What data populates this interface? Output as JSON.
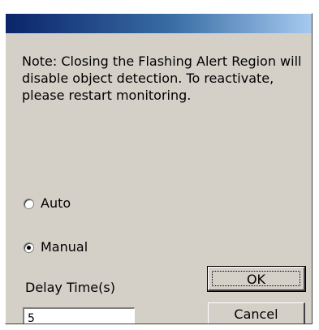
{
  "dialog": {
    "note": "Note: Closing the Flashing Alert Region will disable object detection. To reactivate, please restart monitoring."
  },
  "mode": {
    "options": [
      {
        "label": "Auto",
        "selected": false
      },
      {
        "label": "Manual",
        "selected": true
      }
    ]
  },
  "delay": {
    "label": "Delay Time(s)",
    "value": "5"
  },
  "buttons": {
    "ok_label": "OK",
    "cancel_label": "Cancel"
  }
}
